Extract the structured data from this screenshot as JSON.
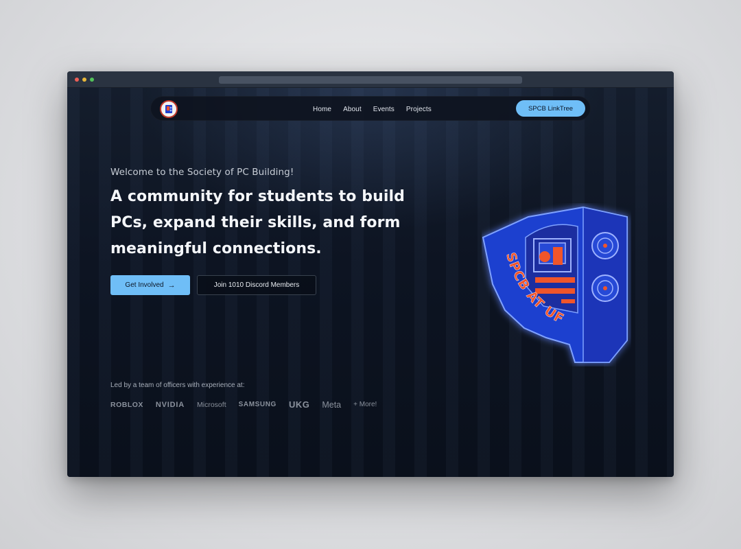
{
  "nav": {
    "links": [
      "Home",
      "About",
      "Events",
      "Projects"
    ],
    "cta_label": "SPCB LinkTree"
  },
  "hero": {
    "welcome": "Welcome to the Society of PC Building!",
    "headline_lines": [
      "A community for students to build",
      "PCs, expand their skills, and form",
      "meaningful connections."
    ],
    "primary_button": "Get Involved",
    "secondary_button": "Join 1010 Discord Members"
  },
  "officers": {
    "intro": "Led by a team of officers with experience at:",
    "companies": [
      "ROBLOX",
      "NVIDIA",
      "Microsoft",
      "SAMSUNG",
      "UKG",
      "Meta"
    ],
    "more_label": "+ More!"
  },
  "mascot": {
    "text": "SPCB AT UF"
  },
  "colors": {
    "accent": "#6fbef7",
    "background": "#0b111c",
    "mascot_blue": "#1f3fcf",
    "mascot_orange": "#f0552a"
  },
  "icons": {
    "primary_button_icon": "arrow-right-icon",
    "logo": "spcb-logo-icon"
  }
}
